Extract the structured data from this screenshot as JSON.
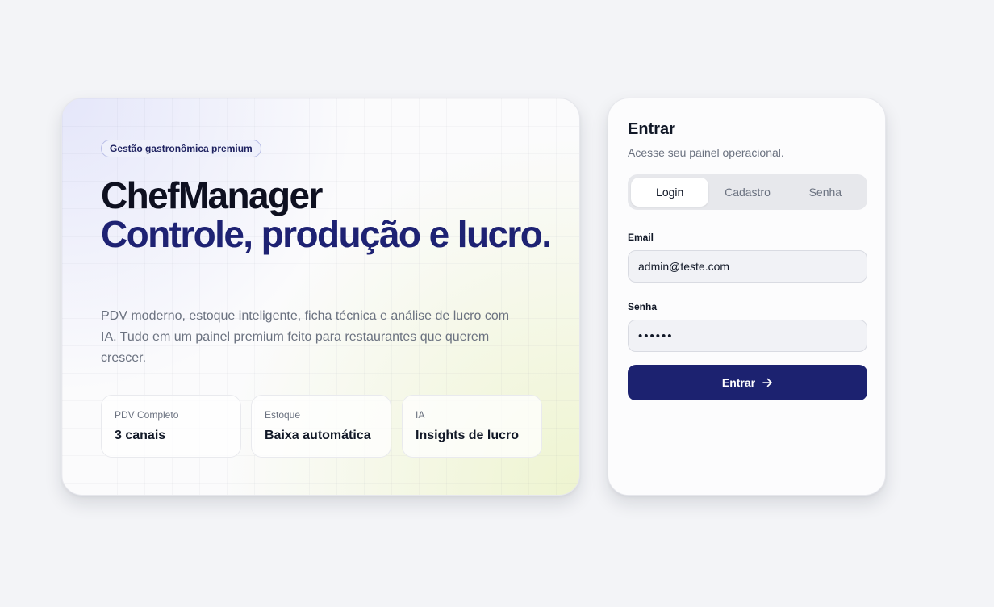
{
  "hero": {
    "badge": "Gestão gastronômica premium",
    "title_line1": "ChefManager",
    "title_line2": "Controle, produção e lucro.",
    "description": "PDV moderno, estoque inteligente, ficha técnica e análise de lucro com IA. Tudo em um painel premium feito para restaurantes que querem crescer.",
    "stats": [
      {
        "label": "PDV Completo",
        "value": "3 canais"
      },
      {
        "label": "Estoque",
        "value": "Baixa automática"
      },
      {
        "label": "IA",
        "value": "Insights de lucro"
      }
    ]
  },
  "login": {
    "title": "Entrar",
    "subtitle": "Acesse seu painel operacional.",
    "tabs": [
      {
        "label": "Login",
        "active": true
      },
      {
        "label": "Cadastro",
        "active": false
      },
      {
        "label": "Senha",
        "active": false
      }
    ],
    "email_label": "Email",
    "email_value": "admin@teste.com",
    "password_label": "Senha",
    "password_value": "••••••",
    "submit_label": "Entrar",
    "submit_icon": "arrow-right-icon"
  },
  "colors": {
    "background": "#f3f4f7",
    "accent": "#1c2270",
    "title_accent": "#1e2273"
  }
}
